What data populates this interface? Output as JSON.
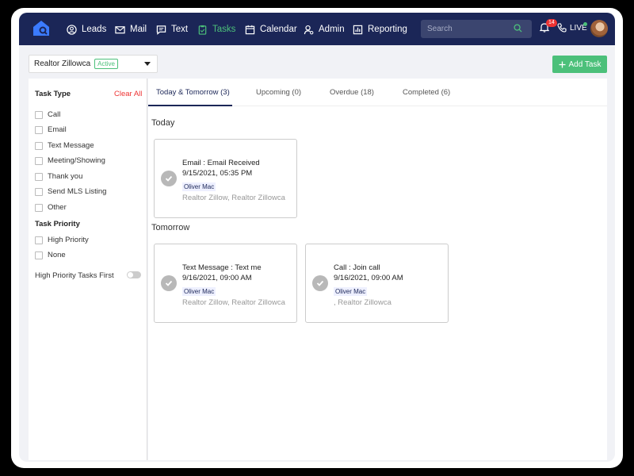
{
  "nav": {
    "items": [
      {
        "label": "Leads",
        "icon": "user-circle-icon"
      },
      {
        "label": "Mail",
        "icon": "envelope-icon"
      },
      {
        "label": "Text",
        "icon": "message-icon"
      },
      {
        "label": "Tasks",
        "icon": "clipboard-icon",
        "active": true
      },
      {
        "label": "Calendar",
        "icon": "calendar-icon"
      },
      {
        "label": "Admin",
        "icon": "admin-user-icon"
      },
      {
        "label": "Reporting",
        "icon": "chart-icon"
      }
    ],
    "search_placeholder": "Search",
    "notification_count": "14",
    "live_label": "LIVE",
    "accent_color": "#4cc07a",
    "bar_color": "#1b2657"
  },
  "toolbar": {
    "selected_user": "Realtor Zillowca",
    "status_badge": "Active",
    "add_task_label": "Add Task"
  },
  "sidebar": {
    "task_type_heading": "Task Type",
    "clear_all": "Clear All",
    "task_types": [
      "Call",
      "Email",
      "Text Message",
      "Meeting/Showing",
      "Thank you",
      "Send MLS Listing",
      "Other"
    ],
    "priority_heading": "Task Priority",
    "priorities": [
      "High Priority",
      "None"
    ],
    "toggle_label": "High Priority Tasks First"
  },
  "tabs": [
    {
      "label": "Today & Tomorrow (3)",
      "active": true
    },
    {
      "label": "Upcoming (0)"
    },
    {
      "label": "Overdue (18)"
    },
    {
      "label": "Completed (6)"
    }
  ],
  "sections": {
    "today": "Today",
    "tomorrow": "Tomorrow"
  },
  "cards": [
    {
      "title": "Email : Email Received",
      "date": "9/15/2021, 05:35 PM",
      "owner": "Oliver Mac",
      "associated": "Realtor Zillow, Realtor Zillowca"
    },
    {
      "title": "Text Message : Text me",
      "date": "9/16/2021, 09:00 AM",
      "owner": "Oliver Mac",
      "associated": "Realtor Zillow, Realtor Zillowca"
    },
    {
      "title": "Call : Join call",
      "date": "9/16/2021, 09:00 AM",
      "owner": "Oliver Mac",
      "associated": ", Realtor Zillowca"
    }
  ]
}
